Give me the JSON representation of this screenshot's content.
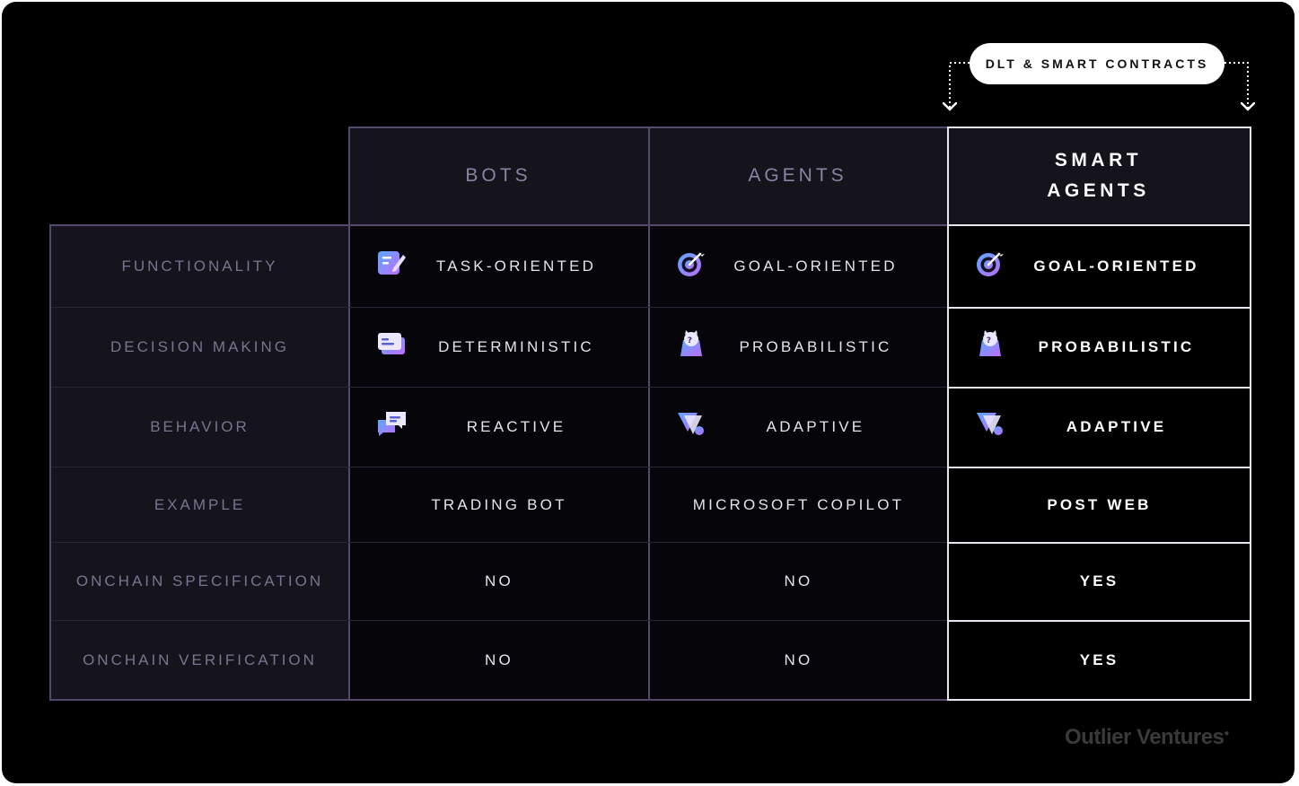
{
  "badge": {
    "label": "DLT & SMART CONTRACTS"
  },
  "columns": [
    {
      "label": "BOTS"
    },
    {
      "label": "AGENTS"
    },
    {
      "label_lines": [
        "SMART",
        "AGENTS"
      ]
    }
  ],
  "rows": [
    {
      "label": "FUNCTIONALITY",
      "values": [
        "TASK-ORIENTED",
        "GOAL-ORIENTED",
        "GOAL-ORIENTED"
      ],
      "icons": [
        "edit-note-icon",
        "target-icon",
        "target-icon"
      ]
    },
    {
      "label": "DECISION MAKING",
      "values": [
        "DETERMINISTIC",
        "PROBABILISTIC",
        "PROBABILISTIC"
      ],
      "icons": [
        "card-icon",
        "lucky-cat-icon",
        "lucky-cat-icon"
      ]
    },
    {
      "label": "BEHAVIOR",
      "values": [
        "REACTIVE",
        "ADAPTIVE",
        "ADAPTIVE"
      ],
      "icons": [
        "chat-bubbles-icon",
        "triangle-shapes-icon",
        "triangle-shapes-icon"
      ]
    },
    {
      "label": "EXAMPLE",
      "values": [
        "TRADING BOT",
        "MICROSOFT COPILOT",
        "POST WEB"
      ]
    },
    {
      "label": "ONCHAIN SPECIFICATION",
      "values": [
        "NO",
        "NO",
        "YES"
      ]
    },
    {
      "label": "ONCHAIN VERIFICATION",
      "values": [
        "NO",
        "NO",
        "YES"
      ]
    }
  ],
  "brand": {
    "name": "Outlier Ventures"
  },
  "colors": {
    "background": "#000000",
    "border": "#54486e",
    "icon_gradient_start": "#5aa8ff",
    "icon_gradient_end": "#c06cff"
  }
}
